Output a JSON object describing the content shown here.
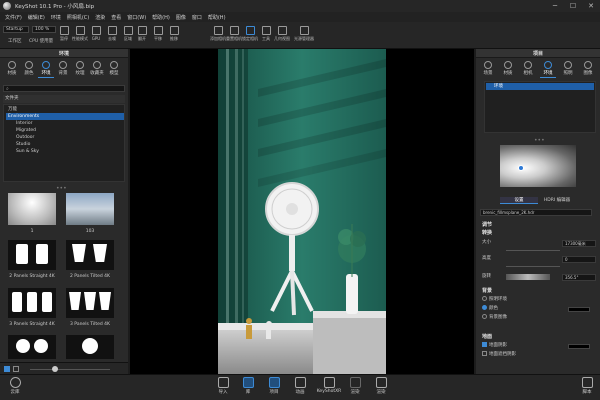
{
  "window": {
    "title": "KeyShot 10.1 Pro - 小风扇.bip",
    "minimize": "─",
    "maximize": "☐",
    "close": "✕"
  },
  "menu": [
    "文件(F)",
    "编辑(E)",
    "环境",
    "照相机(C)",
    "渲染",
    "查看",
    "窗口(W)",
    "帮助(H)",
    "图像",
    "窗口",
    "帮助(H)"
  ],
  "toolbar": {
    "workspace": "Startup",
    "cpu_value": "100 %",
    "cpu_label": "CPU 使用量",
    "workspace_label": "工作区",
    "pause_label": "暂停",
    "perf_label": "性能模式",
    "gpu_label": "GPU",
    "denoise_label": "去噪",
    "area_label": "区域",
    "buttons": [
      "翻开",
      "平移",
      "推移",
      "添加相机",
      "重置相机",
      "锁定相机",
      "工具",
      "几何视图",
      "光源管理器"
    ]
  },
  "left_panel": {
    "header": "环境",
    "tabs": [
      "材质",
      "颜色",
      "环境",
      "背景",
      "纹理",
      "收藏夹",
      "模型"
    ],
    "active_tab": "环境",
    "section_label": "文件夹",
    "tree": [
      "万能",
      "Environments",
      "Interior",
      "Migrated",
      "Outdoor",
      "Studio",
      "Sun & Sky"
    ],
    "selected_tree_item": "Environments",
    "thumbnails": [
      {
        "label": "1"
      },
      {
        "label": "103"
      },
      {
        "label": "2 Panels Straight 4K"
      },
      {
        "label": "2 Panels Tilted 4K"
      },
      {
        "label": "3 Panels Straight 4K"
      },
      {
        "label": "3 Panels Tilted 4K"
      }
    ]
  },
  "right_panel": {
    "header": "项目",
    "tabs": [
      "场景",
      "材质",
      "相机",
      "环境",
      "照明",
      "图像"
    ],
    "active_tab": "环境",
    "env_list_item": "环境",
    "subtabs": [
      "设置",
      "HDRI 编辑器"
    ],
    "hdri_file": "brenic_fillmsplane_2K.hdr",
    "sections": {
      "adjust": "调节",
      "transform": "转换",
      "background": "背景",
      "ground": "地面"
    },
    "size_label": "大小",
    "size_value": "17300毫米",
    "height_label": "高度",
    "height_value": "0",
    "rotation_label": "旋转",
    "rotation_value": "356.5°",
    "bg_options": [
      "照明环境",
      "颜色",
      "背景图像"
    ],
    "bg_selected": "颜色",
    "ground_options": [
      "地面阴影",
      "地面遮挡阴影"
    ]
  },
  "bottombar": {
    "left": "云库",
    "right": "脚本",
    "buttons": [
      "导入",
      "库",
      "项目",
      "动画",
      "KeyShotXR",
      "渲染",
      "渲染"
    ],
    "active": "项目"
  },
  "colors": {
    "accent": "#3d8bd6",
    "wall": "#1f6e5e",
    "selection": "#1f5fa8"
  }
}
